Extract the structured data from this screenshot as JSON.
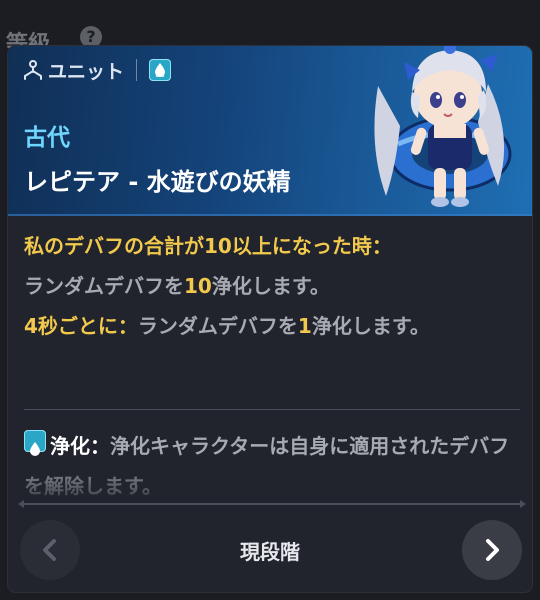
{
  "background": {
    "section_label": "等級",
    "help_glyph": "?"
  },
  "unit_card": {
    "unit_label": "ユニット",
    "era": "古代",
    "name": "レピテア - 水遊びの妖精",
    "ability": {
      "trigger": "私のデバフの合計が10以上になった時：",
      "effect1_pre": "ランダムデバフを",
      "effect1_num": "10",
      "effect1_post": "浄化します。",
      "periodic_trigger": "4秒ごとに：",
      "effect2_pre": "ランダムデバフを",
      "effect2_num": "1",
      "effect2_post": "浄化します。"
    },
    "keyword": {
      "name": "浄化：",
      "text": "浄化キャラクターは自身に適用されたデバフを解除します。"
    },
    "footer": {
      "stage_label": "現段階"
    }
  },
  "colors": {
    "highlight": "#f2c94c",
    "era": "#6fd6ff",
    "water_badge": "#2aa6c6"
  }
}
